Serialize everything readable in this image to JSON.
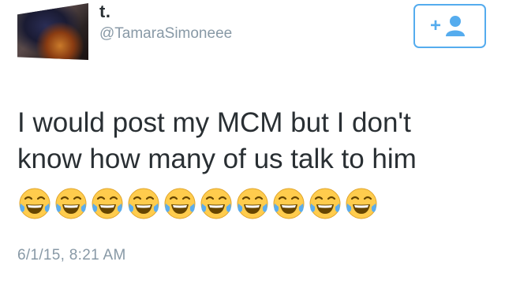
{
  "tweet": {
    "display_name": "t.",
    "handle": "@TamaraSimoneee",
    "text_line_1": "I would post my MCM but I don't",
    "text_line_2": "know how many of us talk to him",
    "emoji_name": "face-with-tears-of-joy-icon",
    "emoji_count": 10,
    "timestamp": "6/1/15, 8:21 AM"
  },
  "follow_button": {
    "icon": "add-user-icon",
    "label": "+"
  },
  "colors": {
    "accent": "#55acee",
    "text": "#292f33",
    "secondary_text": "#8899a6",
    "emoji_face": "#ffcc4d",
    "emoji_tears": "#5dadec"
  }
}
